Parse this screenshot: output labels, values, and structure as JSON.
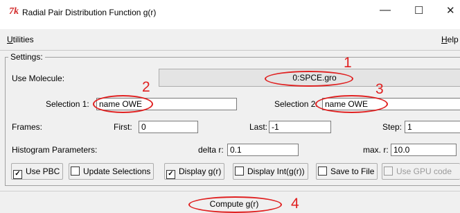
{
  "window": {
    "logo_text": "7k",
    "title": "Radial Pair Distribution Function g(r)",
    "controls": {
      "minimize": "—",
      "maximize": "☐",
      "close": "✕"
    }
  },
  "menu": {
    "utilities_first": "U",
    "utilities_rest": "tilities",
    "help_first": "H",
    "help_rest": "elp"
  },
  "settings": {
    "legend": "Settings:",
    "use_molecule_label": "Use Molecule:",
    "molecule_value": "0:SPCE.gro",
    "selection1_label": "Selection 1:",
    "selection1_value": "name OWE",
    "selection2_label": "Selection 2:",
    "selection2_value": "name OWE",
    "frames_label": "Frames:",
    "first_label": "First:",
    "first_value": "0",
    "last_label": "Last:",
    "last_value": "-1",
    "step_label": "Step:",
    "step_value": "1",
    "histogram_label": "Histogram Parameters:",
    "delta_label": "delta r:",
    "delta_value": "0.1",
    "max_label": "max. r:",
    "max_value": "10.0"
  },
  "options": [
    {
      "label": "Use PBC",
      "checked": true,
      "enabled": true
    },
    {
      "label": "Update Selections",
      "checked": false,
      "enabled": true
    },
    {
      "label": "Display g(r)",
      "checked": true,
      "enabled": true
    },
    {
      "label": "Display Int(g(r))",
      "checked": false,
      "enabled": true
    },
    {
      "label": "Save to File",
      "checked": false,
      "enabled": true
    },
    {
      "label": "Use GPU code",
      "checked": false,
      "enabled": false
    }
  ],
  "compute_label": "Compute g(r)",
  "annotations": [
    "1",
    "2",
    "3",
    "4"
  ],
  "colors": {
    "annotation": "#e02020",
    "titlebar": "#ffffff",
    "window_bg": "#f0f0f0"
  }
}
